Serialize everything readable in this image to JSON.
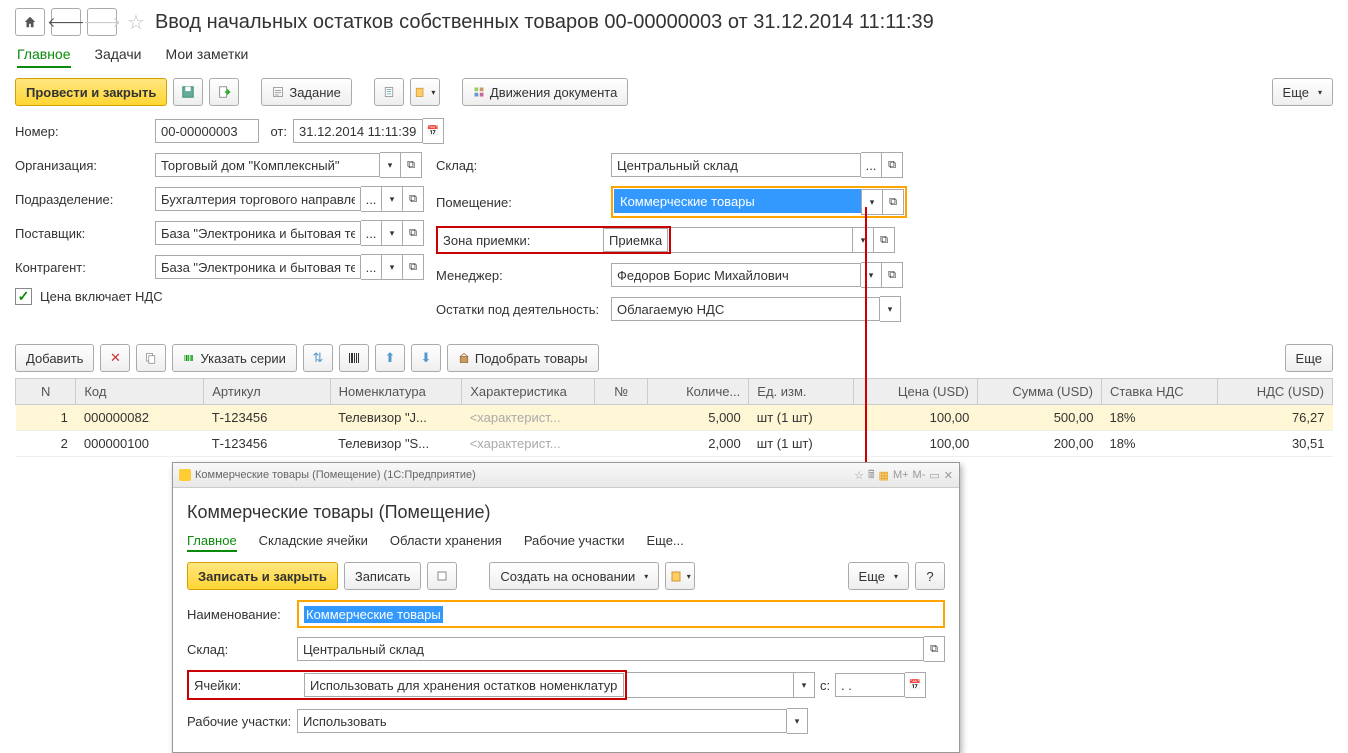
{
  "header": {
    "title": "Ввод начальных остатков собственных товаров 00-00000003 от 31.12.2014 11:11:39"
  },
  "tabs": {
    "t1": "Главное",
    "t2": "Задачи",
    "t3": "Мои заметки"
  },
  "toolbar": {
    "post_close": "Провести и закрыть",
    "task": "Задание",
    "movements": "Движения документа",
    "more": "Еще"
  },
  "form": {
    "number_lbl": "Номер:",
    "number": "00-00000003",
    "from_lbl": "от:",
    "from": "31.12.2014 11:11:39",
    "org_lbl": "Организация:",
    "org": "Торговый дом \"Комплексный\"",
    "warehouse_lbl": "Склад:",
    "warehouse": "Центральный склад",
    "dept_lbl": "Подразделение:",
    "dept": "Бухгалтерия торгового направления",
    "room_lbl": "Помещение:",
    "room": "Коммерческие товары",
    "supplier_lbl": "Поставщик:",
    "supplier": "База \"Электроника и бытовая техника\"",
    "zone_lbl": "Зона приемки:",
    "zone": "Приемка",
    "counterparty_lbl": "Контрагент:",
    "counterparty": "База \"Электроника и бытовая техника\"",
    "manager_lbl": "Менеджер:",
    "manager": "Федоров Борис Михайлович",
    "price_vat": "Цена включает НДС",
    "activity_lbl": "Остатки под деятельность:",
    "activity": "Облагаемую НДС"
  },
  "tbl_toolbar": {
    "add": "Добавить",
    "series": "Указать серии",
    "pick": "Подобрать товары",
    "more": "Еще"
  },
  "table": {
    "headers": {
      "n": "N",
      "code": "Код",
      "art": "Артикул",
      "nom": "Номенклатура",
      "char": "Характеристика",
      "num": "№",
      "qty": "Количе...",
      "unit": "Ед. изм.",
      "price": "Цена (USD)",
      "sum": "Сумма (USD)",
      "vat_rate": "Ставка НДС",
      "vat": "НДС (USD)"
    },
    "rows": [
      {
        "n": "1",
        "code": "000000082",
        "art": "Т-123456",
        "nom": "Телевизор \"J...",
        "char": "<характерист...",
        "qty": "5,000",
        "unit": "шт (1 шт)",
        "price": "100,00",
        "sum": "500,00",
        "vat_rate": "18%",
        "vat": "76,27"
      },
      {
        "n": "2",
        "code": "000000100",
        "art": "Т-123456",
        "nom": "Телевизор \"S...",
        "char": "<характерист...",
        "qty": "2,000",
        "unit": "шт (1 шт)",
        "price": "100,00",
        "sum": "200,00",
        "vat_rate": "18%",
        "vat": "30,51"
      }
    ]
  },
  "modal": {
    "window_title": "Коммерческие товары (Помещение)   (1С:Предприятие)",
    "mplus": "M+",
    "mminus": "M-",
    "title": "Коммерческие товары (Помещение)",
    "tabs": {
      "t1": "Главное",
      "t2": "Складские ячейки",
      "t3": "Области хранения",
      "t4": "Рабочие участки",
      "t5": "Еще..."
    },
    "toolbar": {
      "save_close": "Записать и закрыть",
      "save": "Записать",
      "create_based": "Создать на основании",
      "more": "Еще",
      "help": "?"
    },
    "name_lbl": "Наименование:",
    "name": "Коммерческие товары",
    "warehouse_lbl": "Склад:",
    "warehouse": "Центральный склад",
    "cells_lbl": "Ячейки:",
    "cells": "Использовать для хранения остатков номенклатуры",
    "c_lbl": "с:",
    "c_val": ". .",
    "areas_lbl": "Рабочие участки:",
    "areas": "Использовать"
  }
}
